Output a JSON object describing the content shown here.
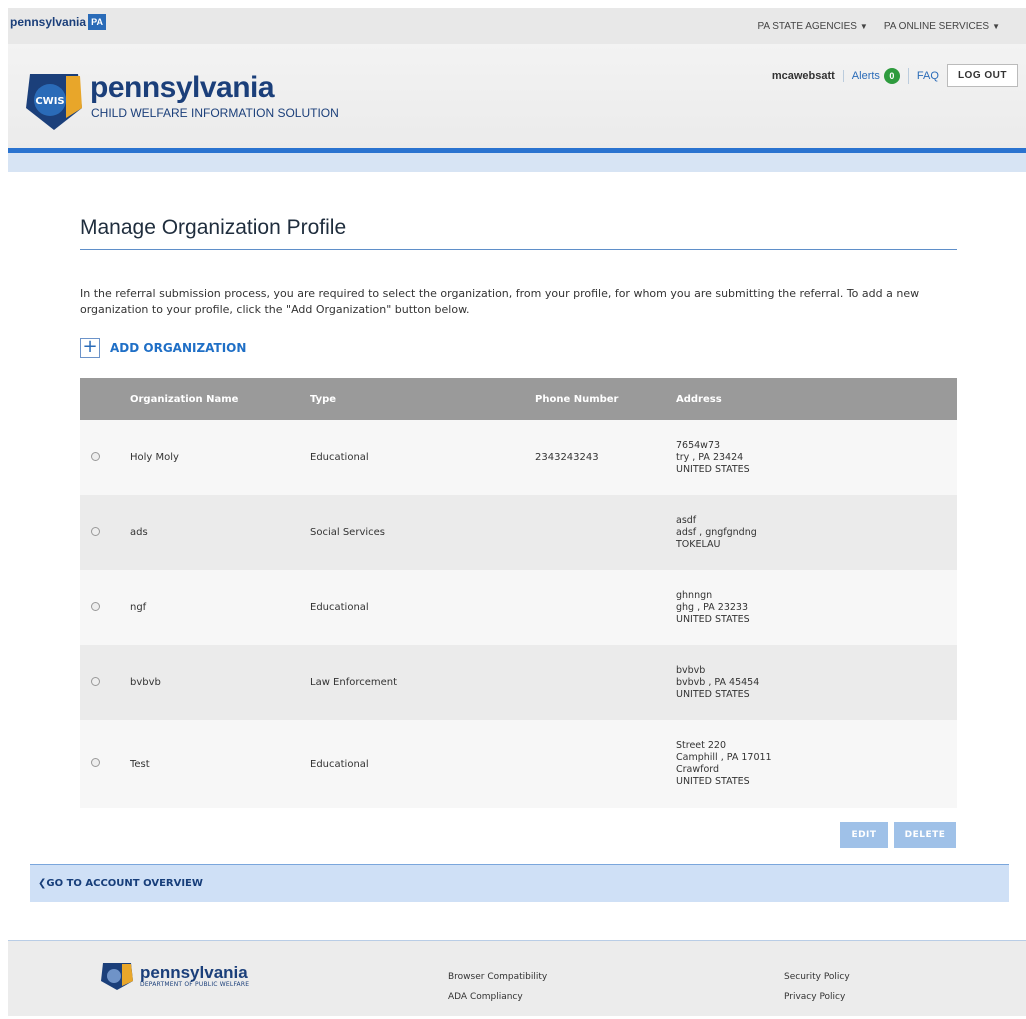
{
  "topbar": {
    "logo_text": "pennsylvania",
    "logo_badge": "PA",
    "nav": [
      "PA STATE AGENCIES",
      "PA ONLINE SERVICES"
    ]
  },
  "header": {
    "badge_text": "CWIS",
    "title": "pennsylvania",
    "subtitle": "CHILD WELFARE INFORMATION SOLUTION",
    "username": "mcawebsatt",
    "alerts_label": "Alerts",
    "alerts_count": "0",
    "faq_label": "FAQ",
    "logout_label": "LOG OUT"
  },
  "main": {
    "title": "Manage Organization Profile",
    "intro": "In the referral submission process, you are required to select the organization, from your profile, for whom you are submitting the referral. To add a new organization to your profile, click the \"Add Organization\" button below.",
    "add_label": "ADD ORGANIZATION",
    "table": {
      "headers": [
        "Organization Name",
        "Type",
        "Phone Number",
        "Address"
      ],
      "rows": [
        {
          "name": "Holy Moly",
          "type": "Educational",
          "phone": "2343243243",
          "addr1": "7654w73",
          "addr2": "try , PA 23424",
          "addr3": "UNITED STATES",
          "addr4": ""
        },
        {
          "name": "ads",
          "type": "Social Services",
          "phone": "",
          "addr1": "asdf",
          "addr2": "adsf , gngfgndng",
          "addr3": "TOKELAU",
          "addr4": ""
        },
        {
          "name": "ngf",
          "type": "Educational",
          "phone": "",
          "addr1": "ghnngn",
          "addr2": "ghg , PA 23233",
          "addr3": "UNITED STATES",
          "addr4": ""
        },
        {
          "name": "bvbvb",
          "type": "Law Enforcement",
          "phone": "",
          "addr1": "bvbvb",
          "addr2": "bvbvb , PA 45454",
          "addr3": "UNITED STATES",
          "addr4": ""
        },
        {
          "name": "Test",
          "type": "Educational",
          "phone": "",
          "addr1": "Street 220",
          "addr2": "Camphill , PA 17011",
          "addr3": "Crawford",
          "addr4": "UNITED STATES"
        }
      ]
    },
    "edit_label": "EDIT",
    "delete_label": "DELETE",
    "back_label": "GO TO ACCOUNT OVERVIEW"
  },
  "footer": {
    "logo_title": "pennsylvania",
    "logo_sub": "DEPARTMENT OF PUBLIC WELFARE",
    "links_a": [
      "Browser Compatibility",
      "ADA Compliancy"
    ],
    "links_b": [
      "Security Policy",
      "Privacy Policy"
    ]
  }
}
